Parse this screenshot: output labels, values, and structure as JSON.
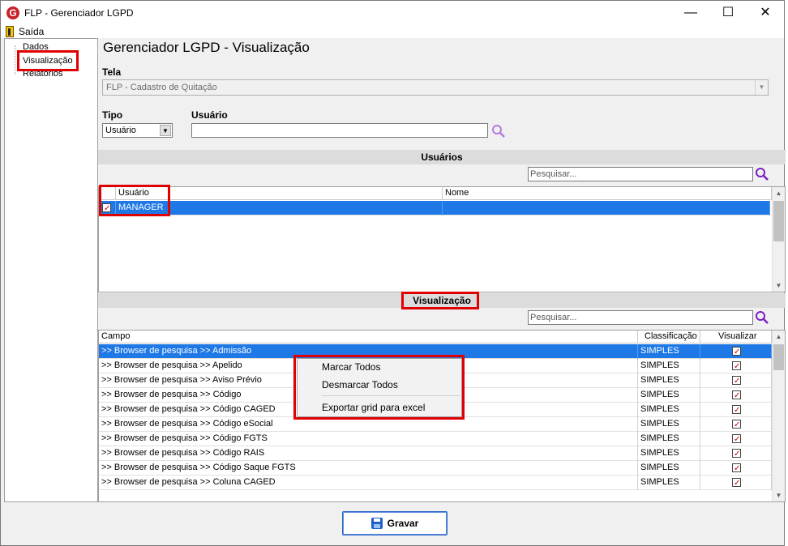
{
  "window": {
    "title": "FLP - Gerenciador LGPD",
    "app_icon": "G",
    "minimize": "—",
    "maximize": "☐",
    "close": "✕"
  },
  "menu": {
    "exit_label": "Saída"
  },
  "sidebar": {
    "items": [
      {
        "label": "Dados"
      },
      {
        "label": "Visualização"
      },
      {
        "label": "Relatórios"
      }
    ]
  },
  "main": {
    "heading": "Gerenciador LGPD - Visualização",
    "tela_label": "Tela",
    "tela_value": "FLP - Cadastro de Quitação",
    "tipo_label": "Tipo",
    "tipo_value": "Usuário",
    "usuario_label": "Usuário",
    "usuario_value": ""
  },
  "users_section": {
    "title": "Usuários",
    "search_placeholder": "Pesquisar...",
    "columns": [
      "Usuário",
      "Nome"
    ],
    "rows": [
      {
        "usuario": "MANAGER",
        "nome": "",
        "checked": true
      }
    ]
  },
  "visual_section": {
    "title": "Visualização",
    "search_placeholder": "Pesquisar...",
    "columns": [
      "Campo",
      "Classificação",
      "Visualizar"
    ],
    "rows": [
      {
        "campo": ">> Browser de pesquisa >> Admissão",
        "classificacao": "SIMPLES",
        "visualizar": true
      },
      {
        "campo": ">> Browser de pesquisa >> Apelido",
        "classificacao": "SIMPLES",
        "visualizar": true
      },
      {
        "campo": ">> Browser de pesquisa >> Aviso Prévio",
        "classificacao": "SIMPLES",
        "visualizar": true
      },
      {
        "campo": ">> Browser de pesquisa >> Código",
        "classificacao": "SIMPLES",
        "visualizar": true
      },
      {
        "campo": ">> Browser de pesquisa >> Código CAGED",
        "classificacao": "SIMPLES",
        "visualizar": true
      },
      {
        "campo": ">> Browser de pesquisa >> Código eSocial",
        "classificacao": "SIMPLES",
        "visualizar": true
      },
      {
        "campo": ">> Browser de pesquisa >> Código FGTS",
        "classificacao": "SIMPLES",
        "visualizar": true
      },
      {
        "campo": ">> Browser de pesquisa >> Código RAIS",
        "classificacao": "SIMPLES",
        "visualizar": true
      },
      {
        "campo": ">> Browser de pesquisa >> Código Saque FGTS",
        "classificacao": "SIMPLES",
        "visualizar": true
      },
      {
        "campo": ">> Browser de pesquisa >> Coluna CAGED",
        "classificacao": "SIMPLES",
        "visualizar": true
      }
    ]
  },
  "context_menu": {
    "items": [
      "Marcar Todos",
      "Desmarcar Todos",
      "Exportar grid para excel"
    ]
  },
  "footer": {
    "save_label": "Gravar"
  },
  "colors": {
    "highlight": "#e00000",
    "selection": "#1e78e6",
    "search_icon": "#8a2be2"
  }
}
